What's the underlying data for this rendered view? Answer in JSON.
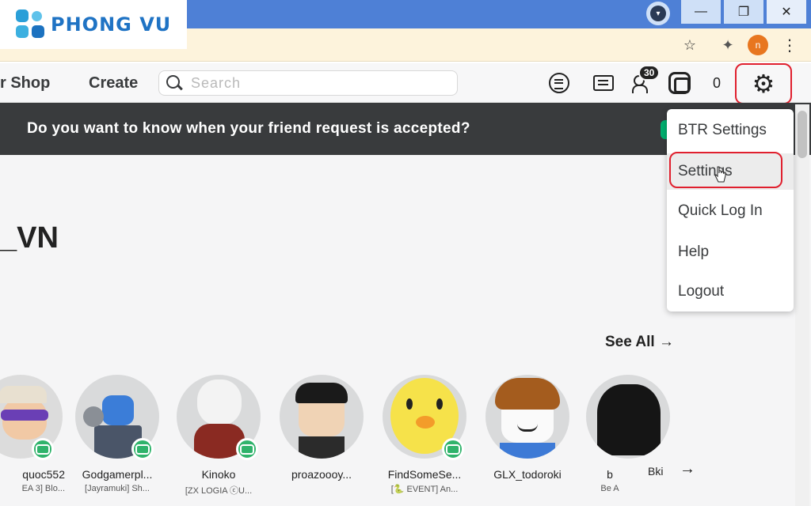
{
  "browser": {
    "extension_initial": "n"
  },
  "logo": {
    "text": "PHONG VU"
  },
  "nav": {
    "shop": "r Shop",
    "create": "Create",
    "search_placeholder": "Search",
    "friend_requests_badge": "30",
    "robux_count": "0"
  },
  "banner": {
    "text": "Do you want to know when your friend request is accepted?"
  },
  "profile": {
    "username": "_VN"
  },
  "friends_section": {
    "see_all": "See All →"
  },
  "friends": [
    {
      "name": "quoc552",
      "status": "EA 3] Blo...",
      "in_game": true
    },
    {
      "name": "Godgamerpl...",
      "status": "[Jayramuki] Sh...",
      "in_game": true
    },
    {
      "name": "Kinoko",
      "status": "[ZX LOGIA ⓒU...",
      "in_game": true
    },
    {
      "name": "proazoooy...",
      "status": "",
      "in_game": false
    },
    {
      "name": "FindSomeSe...",
      "status": "[🐍 EVENT] An...",
      "in_game": true
    },
    {
      "name": "GLX_todoroki",
      "status": "",
      "in_game": false
    },
    {
      "name": "b",
      "status": "Be A",
      "in_game": false
    },
    {
      "name": "Bki",
      "status": "",
      "in_game": false
    }
  ],
  "menu": {
    "items": [
      "BTR Settings",
      "Settings",
      "Quick Log In",
      "Help",
      "Logout"
    ],
    "highlighted": "Settings"
  },
  "icons": [
    "star-icon",
    "puzzle-icon",
    "kebab-menu-icon",
    "search-icon",
    "list-icon",
    "chat-icon",
    "friends-icon",
    "robux-icon",
    "gear-icon",
    "cursor-icon",
    "arrow-right-icon"
  ],
  "colors": {
    "titlebar": "#4e80d6",
    "addressbar": "#fdf3dc",
    "banner": "#393b3d",
    "highlight_ring": "#e0202e",
    "in_game": "#2fb36b",
    "logo": "#1f73c4"
  }
}
